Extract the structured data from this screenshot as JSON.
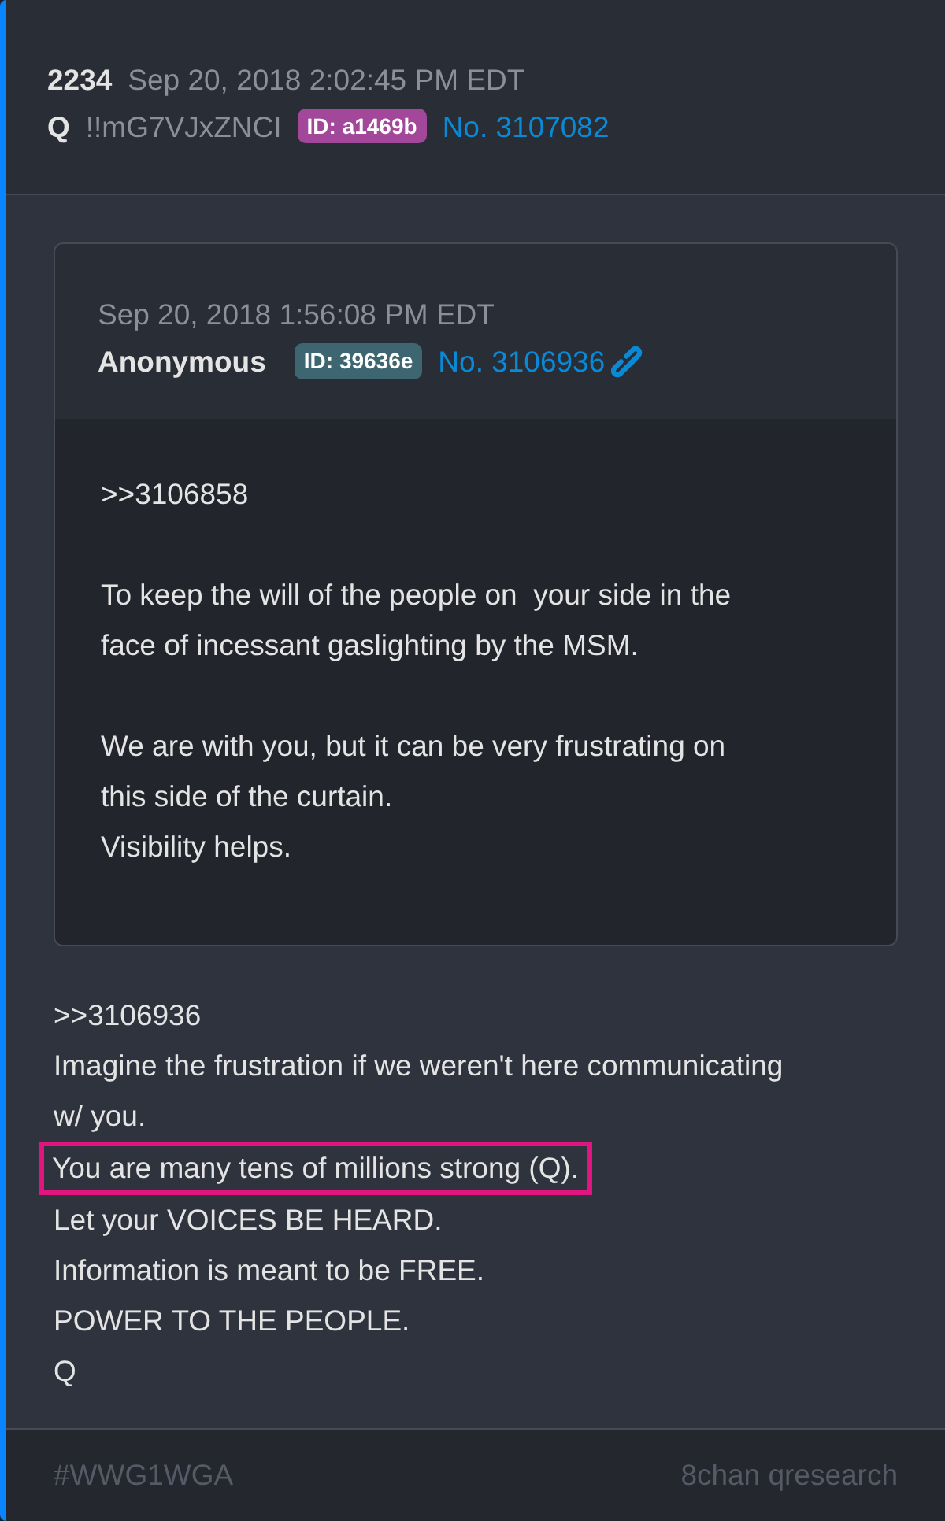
{
  "post": {
    "number": "2234",
    "timestamp": "Sep 20, 2018 2:02:45 PM EDT",
    "author": "Q",
    "tripcode": "!!mG7VJxZNCI",
    "id_badge": {
      "text": "ID: a1469b",
      "color": "#a2479a"
    },
    "post_link": "No. 3107082"
  },
  "quoted_post": {
    "timestamp": "Sep 20, 2018 1:56:08 PM EDT",
    "author": "Anonymous",
    "id_badge": {
      "text": "ID: 39636e",
      "color": "#3d6670"
    },
    "post_link": "No. 3106936",
    "paragraphs": [
      [
        ">>3106858"
      ],
      [
        "To keep the will of the people on  your side in the face of incessant gaslighting by the MSM."
      ],
      [
        "We are with you, but it can be very frustrating on this side of the curtain.",
        "Visibility helps."
      ]
    ]
  },
  "body": [
    {
      "text": ">>3106936",
      "highlighted": false
    },
    {
      "text": "Imagine the frustration if we weren't here communicating w/ you.",
      "highlighted": false
    },
    {
      "text": "You are many tens of millions strong (Q).",
      "highlighted": true
    },
    {
      "text": "Let your VOICES BE HEARD.",
      "highlighted": false
    },
    {
      "text": "Information is meant to be FREE.",
      "highlighted": false
    },
    {
      "text": "POWER TO THE PEOPLE.",
      "highlighted": false
    },
    {
      "text": "Q",
      "highlighted": false
    }
  ],
  "footer": {
    "hashtag": "#WWG1WGA",
    "source": "8chan qresearch"
  }
}
